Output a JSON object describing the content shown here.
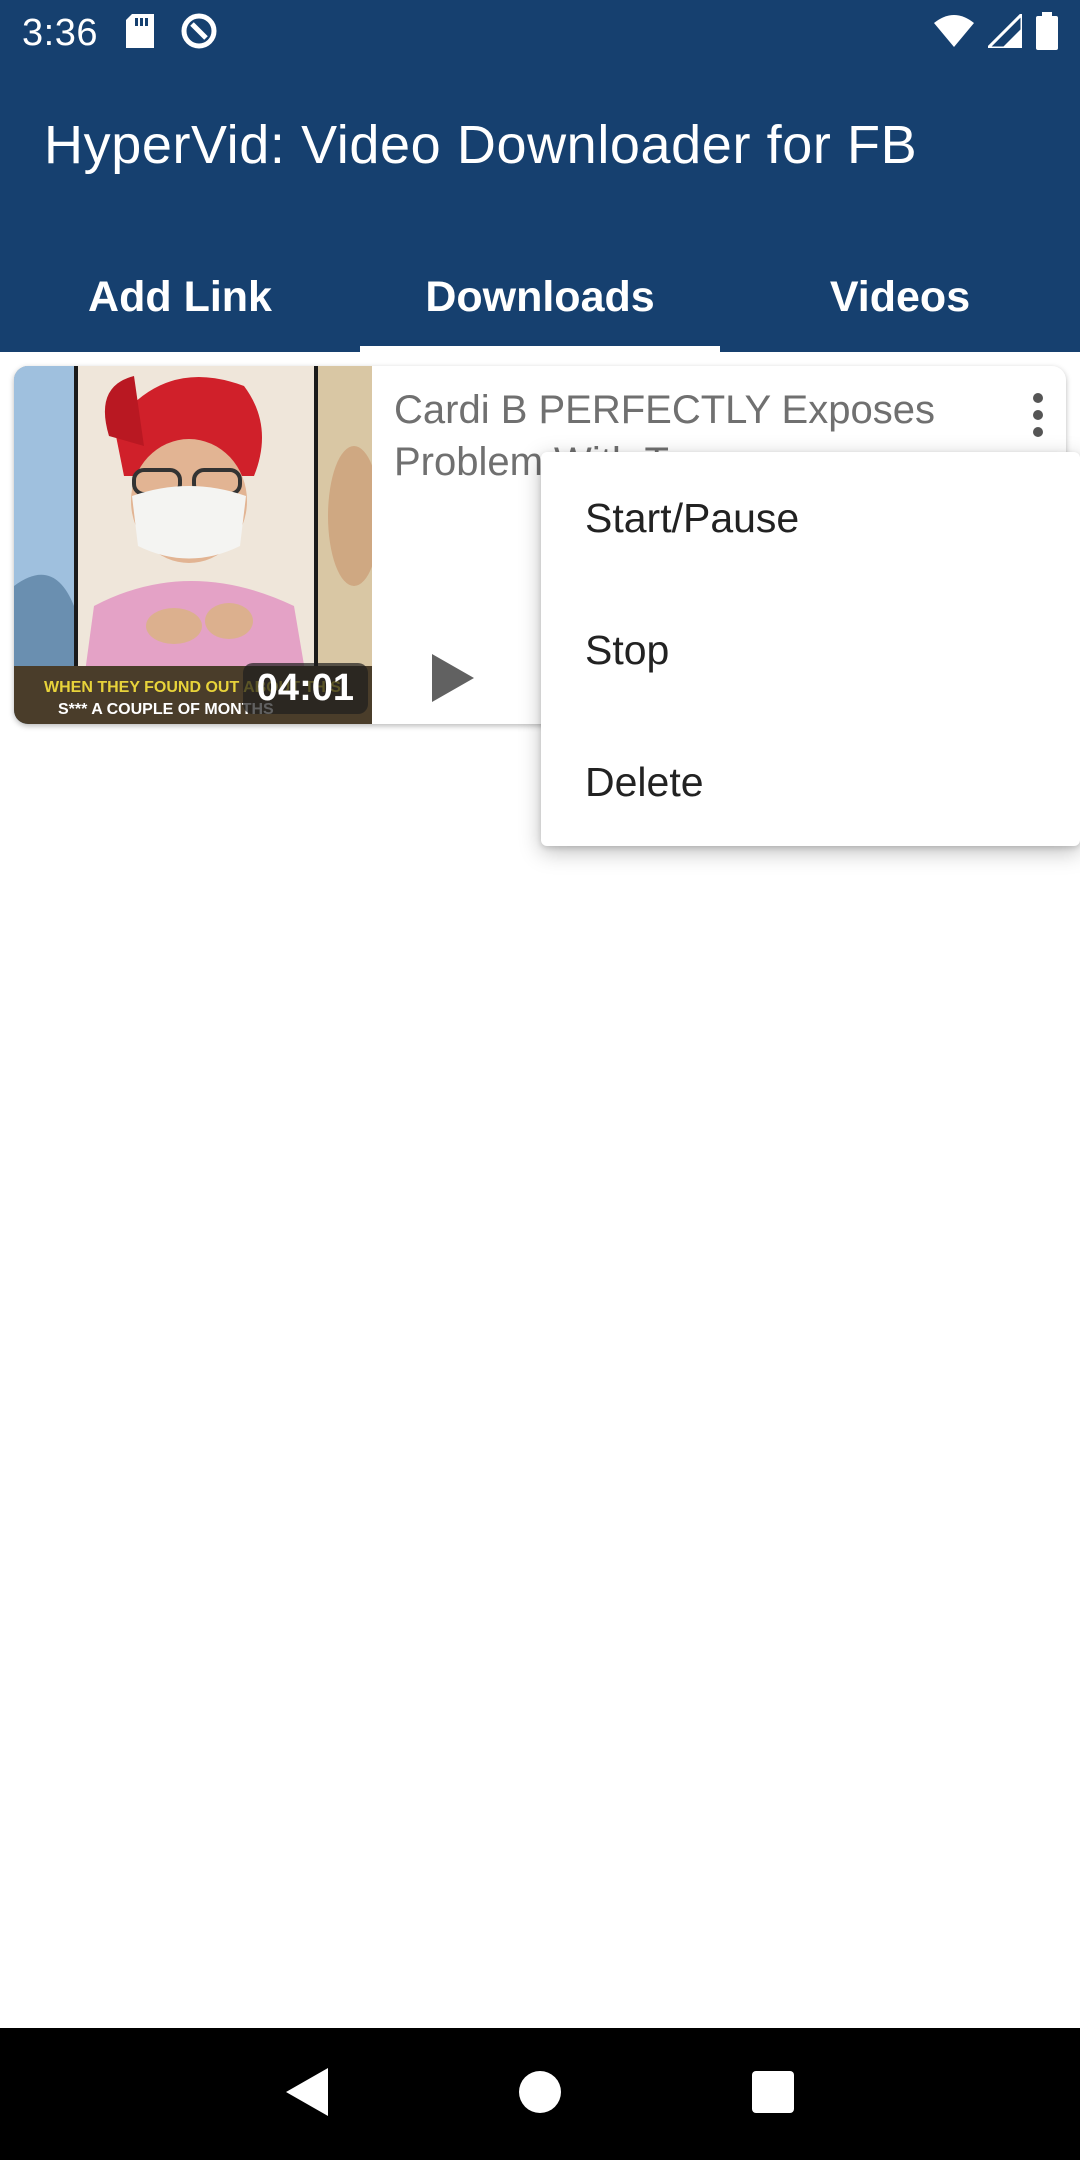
{
  "status_bar": {
    "time": "3:36",
    "icons": [
      "sd-card-icon",
      "sync-icon",
      "wifi-icon",
      "signal-icon",
      "battery-icon"
    ]
  },
  "app_bar": {
    "title": "HyperVid: Video Downloader for FB",
    "background": "#16406f"
  },
  "tabs": [
    {
      "label": "Add Link",
      "active": false
    },
    {
      "label": "Downloads",
      "active": true
    },
    {
      "label": "Videos",
      "active": false
    }
  ],
  "download_item": {
    "title": "Cardi B PERFECTLY Exposes Problem With T",
    "duration": "04:01",
    "thumbnail_caption_line1": "WHEN THEY FOUND OUT ABOUT THIS",
    "thumbnail_caption_line2": "S*** A COUPLE OF MONTHS"
  },
  "context_menu": {
    "items": [
      "Start/Pause",
      "Stop",
      "Delete"
    ]
  },
  "nav_bar": {
    "icons": [
      "back-icon",
      "home-icon",
      "recents-icon"
    ]
  }
}
